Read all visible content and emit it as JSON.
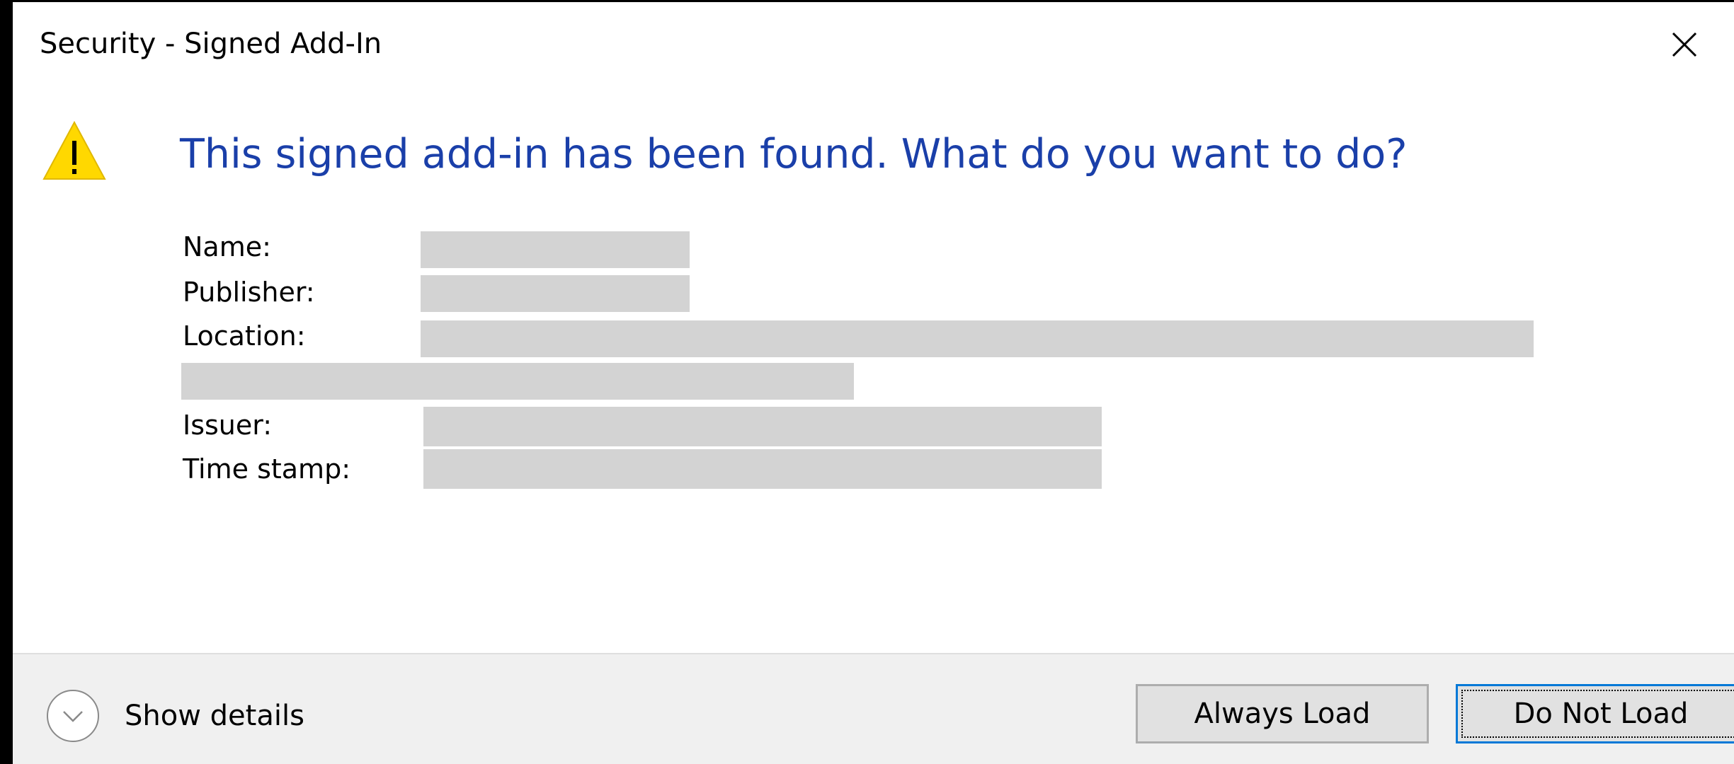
{
  "window": {
    "title": "Security - Signed Add-In"
  },
  "message": {
    "heading": "This signed add-in has been found. What do you want to do?"
  },
  "fields": {
    "name_label": "Name:",
    "publisher_label": "Publisher:",
    "location_label": "Location:",
    "issuer_label": "Issuer:",
    "timestamp_label": "Time stamp:"
  },
  "footer": {
    "show_details_label": "Show details",
    "always_load_label": "Always Load",
    "do_not_load_label": "Do Not Load"
  },
  "colors": {
    "heading": "#1a3fa9",
    "warning_fill": "#ffd800",
    "redaction": "#d3d3d3",
    "focus_border": "#0078d7"
  },
  "icons": {
    "warning": "warning-triangle-icon",
    "close": "close-icon",
    "details": "chevron-down-circle-icon"
  }
}
